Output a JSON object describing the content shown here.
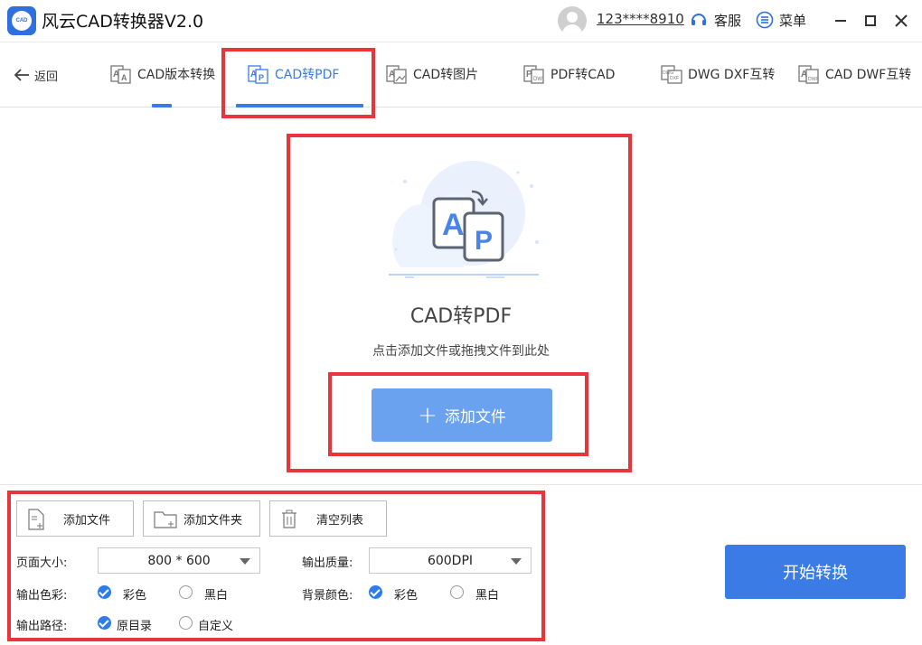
{
  "app": {
    "title": "风云CAD转换器V2.0",
    "logo_text": "CAD",
    "username": "123****8910",
    "service_label": "客服",
    "menu_label": "菜单"
  },
  "nav": {
    "back_label": "返回",
    "tabs": [
      {
        "label": "CAD版本转换",
        "active": false
      },
      {
        "label": "CAD转PDF",
        "active": true
      },
      {
        "label": "CAD转图片",
        "active": false
      },
      {
        "label": "PDF转CAD",
        "active": false
      },
      {
        "label": "DWG DXF互转",
        "active": false
      },
      {
        "label": "CAD DWF互转",
        "active": false
      }
    ]
  },
  "drop": {
    "title": "CAD转PDF",
    "hint": "点击添加文件或拖拽文件到此处",
    "add_button_label": "添加文件",
    "add_button_plus": "+"
  },
  "toolbar": {
    "add_file_label": "添加文件",
    "add_folder_label": "添加文件夹",
    "clear_list_label": "清空列表"
  },
  "settings": {
    "page_size_label": "页面大小:",
    "page_size_value": "800 * 600",
    "quality_label": "输出质量:",
    "quality_value": "600DPI",
    "color_label": "输出色彩:",
    "color_options": [
      "彩色",
      "黑白"
    ],
    "color_selected": "彩色",
    "bg_label": "背景颜色:",
    "bg_options": [
      "彩色",
      "黑白"
    ],
    "bg_selected": "彩色",
    "path_label": "输出路径:",
    "path_options": [
      "原目录",
      "自定义"
    ],
    "path_selected": "原目录"
  },
  "start_button_label": "开始转换",
  "colors": {
    "accent": "#3a7be6",
    "add_button": "#6aa2ef",
    "highlight": "#e8343b"
  }
}
